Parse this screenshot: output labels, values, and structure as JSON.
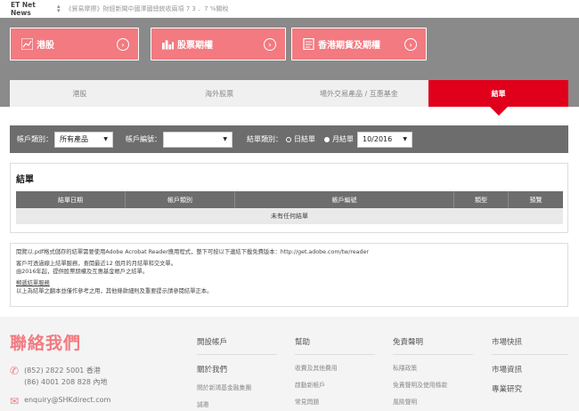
{
  "ticker": {
    "brand": "ET Net News",
    "headline": "《貿易摩擦》財經新聞中國澤國總統收兩項 7 3 ．7 %關稅"
  },
  "quick_links": [
    {
      "label": "港股"
    },
    {
      "label": "股票期權"
    },
    {
      "label": "香港期貨及期權"
    }
  ],
  "tabs": [
    {
      "label": "港股"
    },
    {
      "label": "海外股票"
    },
    {
      "label": "場外交易產品 / 互惠基金"
    },
    {
      "label": "結單"
    }
  ],
  "filter": {
    "account_type_label": "帳戶類別：",
    "account_type_value": "所有產品",
    "account_no_label": "帳戶編號：",
    "account_no_value": "",
    "statement_type_label": "結單類別：",
    "daily_label": "日結單",
    "monthly_label": "月結單",
    "month_value": "10/2016"
  },
  "statement": {
    "title": "結單",
    "columns": [
      "結單日期",
      "帳戶類別",
      "帳戶編號",
      "類型",
      "預覽"
    ],
    "empty_text": "未有任何結單"
  },
  "notes": {
    "line1": "閱覽以.pdf格式儲存的結單需要使用Adobe Acrobat Reader應用程式，整下可按以下連結下載免費版本：http://get.adobe.com/tw/reader",
    "line2": "客戶可透過線上結單服務，查閱最近12 個月的月結單和交文單。",
    "line3": "由2016年起，提供股票期權及互惠基金帳戶之結單。",
    "line4": "郵遞結單服務",
    "line5": "以上為結單之翻本並僅作參考之用，其他條款細則及重要提示請參閱結單正本。"
  },
  "footer": {
    "contact_title": "聯絡我們",
    "phone1": "(852) 2822 5001 香港",
    "phone2": "(86) 4001 208 828 內地",
    "email": "enquiry@SHKdirect.com",
    "col1": {
      "heading": "開設帳戶",
      "sub": "關於我們",
      "items": [
        "開於新鴻基金融集團",
        "誠邀"
      ]
    },
    "col2": {
      "heading": "幫助",
      "items": [
        "收費及其他費用",
        "啟動新帳戶",
        "常見問題"
      ]
    },
    "col3": {
      "heading": "免責聲明",
      "items": [
        "私隱政策",
        "免責聲明及使用條款",
        "風險聲明"
      ]
    },
    "col4": {
      "heading": "市場快訊",
      "items": [
        "市場資訊",
        "專業研究"
      ]
    }
  },
  "colors": {
    "brand_pink": "#f27a80",
    "active_red": "#e0001b",
    "bar_grey": "#6d6d6d"
  }
}
